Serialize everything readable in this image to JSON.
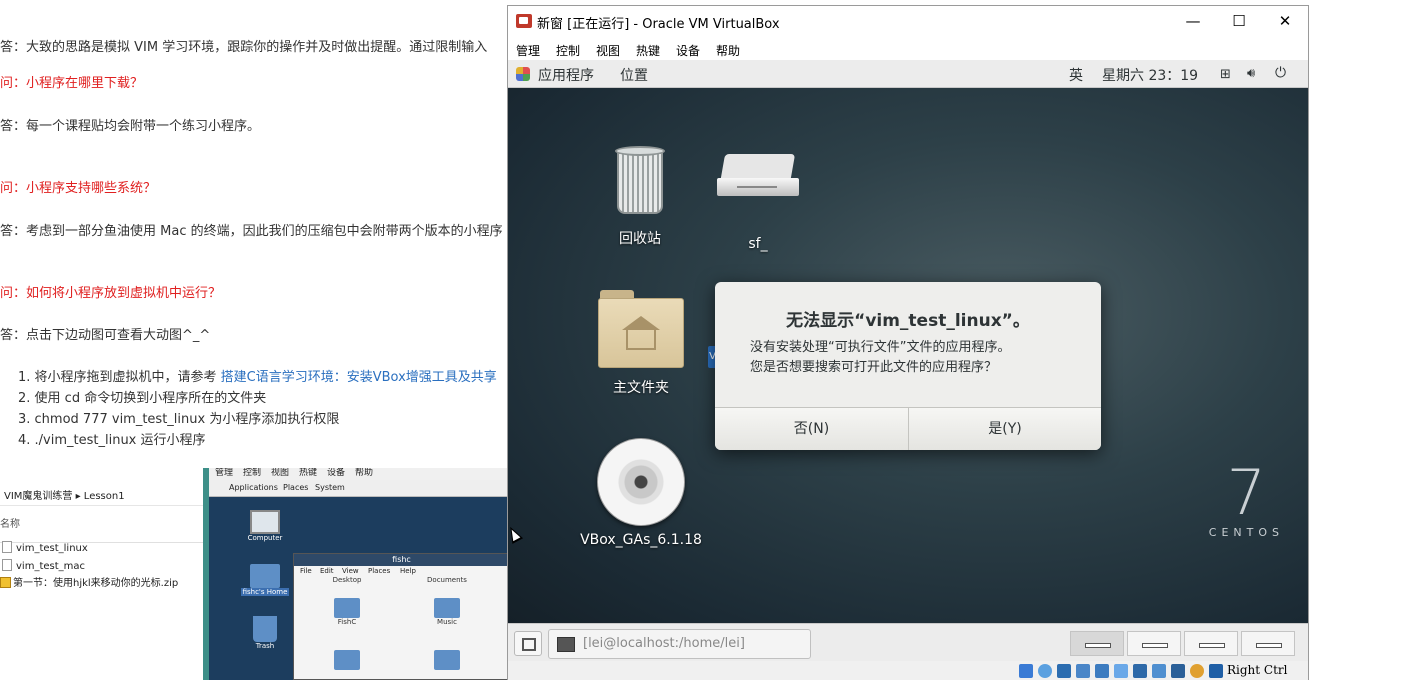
{
  "article": {
    "l1": "答：大致的思路是模拟 VIM 学习环境，跟踪你的操作并及时做出提醒。通过限制输入",
    "q2": "问：小程序在哪里下载？",
    "a2": "答：每一个课程贴均会附带一个练习小程序。",
    "q3": "问：小程序支持哪些系统？",
    "a3": "答：考虑到一部分鱼油使用 Mac 的终端，因此我们的压缩包中会附带两个版本的小程序",
    "q4": "问：如何将小程序放到虚拟机中运行？",
    "a4": "答：点击下边动图可查看大动图^_^",
    "step1_prefix": "1. 将小程序拖到虚拟机中，请参考 ",
    "step1_link": "搭建C语言学习环境：安装VBox增强工具及共享",
    "step2": "2. 使用 cd 命令切换到小程序所在的文件夹",
    "step3": "3. chmod 777 vim_test_linux 为小程序添加执行权限",
    "step4": "4. ./vim_test_linux 运行小程序"
  },
  "embedded": {
    "breadcrumb": "VIM魔鬼训练营 ▸ Lesson1",
    "col_name": "名称",
    "files": [
      "vim_test_linux",
      "vim_test_mac",
      "第一节：使用hjkl来移动你的光标.zip"
    ],
    "vb_menu": [
      "管理",
      "控制",
      "视图",
      "热键",
      "设备",
      "帮助"
    ],
    "gnome_menu": [
      "Applications",
      "Places",
      "System"
    ],
    "desktop_icons": [
      "Computer",
      "fishc's Home",
      "Trash"
    ],
    "fm_title": "fishc",
    "fm_menu": [
      "File",
      "Edit",
      "View",
      "Places",
      "Help"
    ],
    "fm_items": [
      "Desktop",
      "Documents",
      "FishC",
      "Music"
    ]
  },
  "vbox": {
    "title": "新窗 [正在运行] - Oracle VM VirtualBox",
    "controls": {
      "minimize": "—",
      "maximize": "☐",
      "close": "✕"
    },
    "menu": [
      "管理",
      "控制",
      "视图",
      "热键",
      "设备",
      "帮助"
    ],
    "status_hostkey": "Right Ctrl"
  },
  "guest": {
    "top_apps": "应用程序",
    "top_places": "位置",
    "input_method": "英",
    "clock": "星期六 23：19",
    "icons": {
      "trash": "回收站",
      "sf": "sf_",
      "home": "主文件夹",
      "disc": "VBox_GAs_6.1.18"
    },
    "peek_letter": "V",
    "dialog": {
      "title": "无法显示“vim_test_linux”。",
      "line1": "没有安装处理“可执行文件”文件的应用程序。",
      "line2": "您是否想要搜索可打开此文件的应用程序？",
      "no": "否(N)",
      "yes": "是(Y)"
    },
    "brand_number": "7",
    "brand_word": "CENTOS",
    "taskbar_item": "[lei@localhost:/home/lei]",
    "workspaces": 4,
    "active_workspace": 1
  },
  "colors": {
    "question": "#e02020",
    "link": "#2a6fbf",
    "dialog_bg": "#eeeeec"
  }
}
